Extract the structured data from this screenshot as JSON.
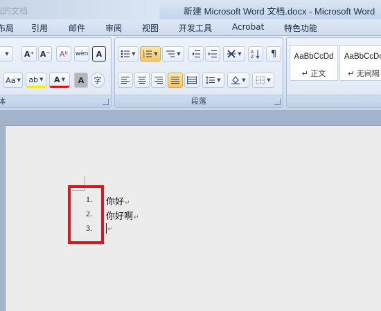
{
  "window": {
    "title": "新建 Microsoft Word 文档.docx - Microsoft Word",
    "ghost_title": "我的文档"
  },
  "tabs": [
    "布局",
    "引用",
    "邮件",
    "审阅",
    "视图",
    "开发工具",
    "Acrobat",
    "特色功能"
  ],
  "ribbon": {
    "font_group_label": "体",
    "paragraph_group_label": "段落",
    "font_buttons": {
      "grow": "A⁺",
      "shrink": "A⁻",
      "clear_format": "Aᵇ",
      "phonetic": "wén",
      "char_border": "A",
      "change_case": "Aa",
      "highlight": "ab",
      "font_color": "A",
      "char_shading": "A",
      "enclose": "字"
    },
    "styles": [
      {
        "sample": "AaBbCcDd",
        "name": "↵ 正文"
      },
      {
        "sample": "AaBbCcDc",
        "name": "↵ 无间隔"
      }
    ]
  },
  "document": {
    "list": [
      {
        "number": "1.",
        "text": "你好"
      },
      {
        "number": "2.",
        "text": "你好啊"
      },
      {
        "number": "3.",
        "text": ""
      }
    ],
    "paragraph_mark": "↵"
  },
  "colors": {
    "highlight_box": "#e0141c",
    "ribbon_bg": "#dce7f5",
    "active_button": "#f7c75f"
  }
}
